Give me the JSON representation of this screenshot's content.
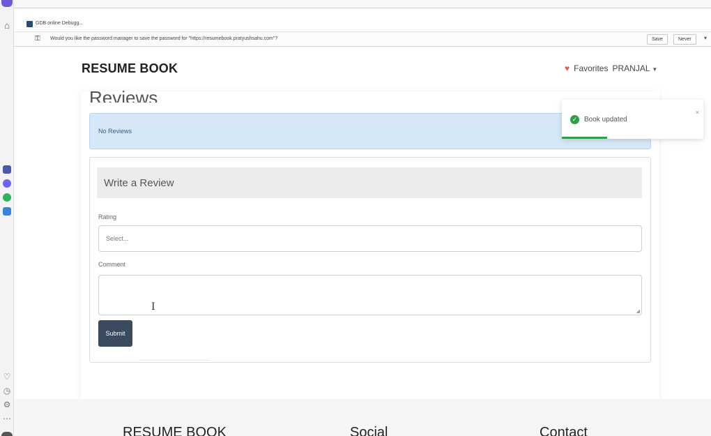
{
  "browser": {
    "tab_title": "GDB online Debugg...",
    "password_prompt": "Would you like the password manager to save the password for \"https://resumebook.pratyushsahu.com\"?",
    "save_label": "Save",
    "never_label": "Never"
  },
  "navbar": {
    "brand": "RESUME BOOK",
    "favorites": "Favorites",
    "user": "PRANJAL"
  },
  "reviews": {
    "heading": "Reviews",
    "empty_message": "No Reviews"
  },
  "form": {
    "title": "Write a Review",
    "rating_label": "Rating",
    "rating_placeholder": "Select...",
    "comment_label": "Comment",
    "submit_label": "Submit"
  },
  "toast": {
    "message": "Book updated",
    "close": "×",
    "progress": 0.32
  },
  "footer": {
    "brand": "RESUME BOOK",
    "social": "Social",
    "contact": "Contact"
  },
  "colors": {
    "accent": "#3a4b60",
    "info_bg": "#d6e8f7",
    "success": "#2e9e47"
  }
}
